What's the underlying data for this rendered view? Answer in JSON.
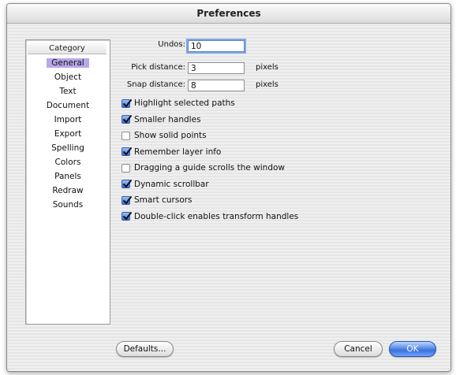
{
  "window": {
    "title": "Preferences"
  },
  "sidebar": {
    "header": "Category",
    "items": [
      {
        "label": "General",
        "selected": true
      },
      {
        "label": "Object"
      },
      {
        "label": "Text"
      },
      {
        "label": "Document"
      },
      {
        "label": "Import"
      },
      {
        "label": "Export"
      },
      {
        "label": "Spelling"
      },
      {
        "label": "Colors"
      },
      {
        "label": "Panels"
      },
      {
        "label": "Redraw"
      },
      {
        "label": "Sounds"
      }
    ]
  },
  "fields": {
    "undos": {
      "label": "Undos:",
      "value": "10"
    },
    "pick": {
      "label": "Pick distance:",
      "value": "3",
      "units": "pixels"
    },
    "snap": {
      "label": "Snap distance:",
      "value": "8",
      "units": "pixels"
    }
  },
  "options": [
    {
      "label": "Highlight selected paths",
      "checked": true
    },
    {
      "label": "Smaller handles",
      "checked": true
    },
    {
      "label": "Show solid points",
      "checked": false
    },
    {
      "label": "Remember layer info",
      "checked": true
    },
    {
      "label": "Dragging a guide scrolls the window",
      "checked": false
    },
    {
      "label": "Dynamic scrollbar",
      "checked": true
    },
    {
      "label": "Smart cursors",
      "checked": true
    },
    {
      "label": "Double-click enables transform handles",
      "checked": true
    }
  ],
  "buttons": {
    "defaults": "Defaults...",
    "cancel": "Cancel",
    "ok": "OK"
  },
  "colors": {
    "accent": "#3b72db",
    "selection": "#b9a7e9"
  }
}
